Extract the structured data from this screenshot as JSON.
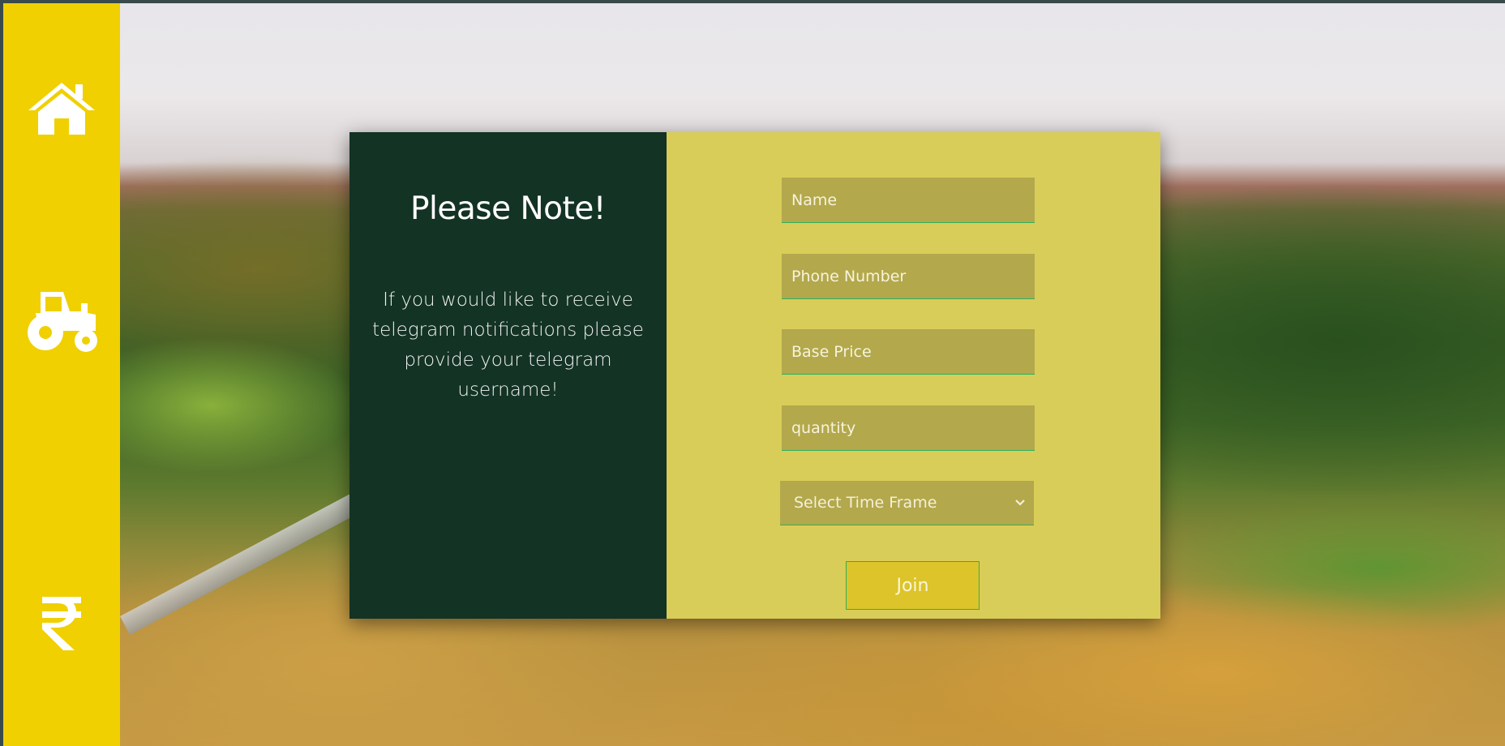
{
  "sidebar": {
    "items": [
      {
        "icon": "home-icon"
      },
      {
        "icon": "tractor-icon"
      },
      {
        "icon": "rupee-icon"
      }
    ]
  },
  "note": {
    "title": "Please Note!",
    "text": "If you would like to receive telegram notifications please provide your telegram username!"
  },
  "form": {
    "name_placeholder": "Name",
    "phone_placeholder": "Phone Number",
    "price_placeholder": "Base Price",
    "quantity_placeholder": "quantity",
    "time_frame_selected": "Select Time Frame",
    "join_label": "Join"
  },
  "colors": {
    "sidebar": "#f0d000",
    "note_panel": "#133324",
    "form_panel": "#d8cd58",
    "input_bg": "#b3a84c",
    "input_border": "#2fb05a",
    "button_bg": "#dcc42a"
  }
}
